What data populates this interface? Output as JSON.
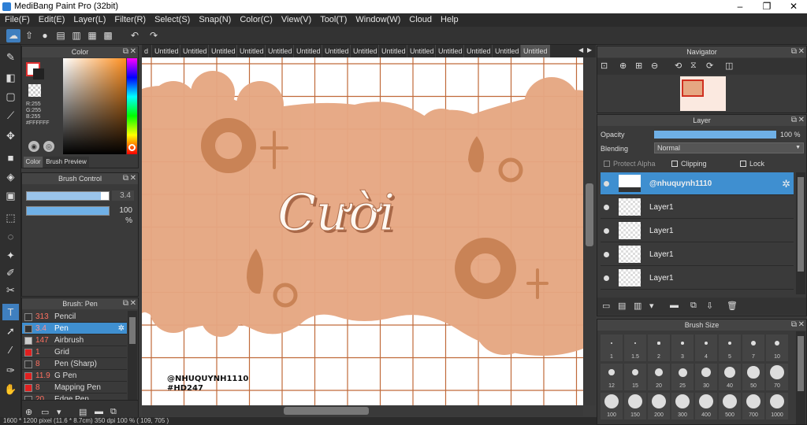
{
  "window": {
    "title": "MediBang Paint Pro (32bit)",
    "min": "–",
    "max": "❐",
    "close": "✕"
  },
  "menu": [
    "File(F)",
    "Edit(E)",
    "Layer(L)",
    "Filter(R)",
    "Select(S)",
    "Snap(N)",
    "Color(C)",
    "View(V)",
    "Tool(T)",
    "Window(W)",
    "Cloud",
    "Help"
  ],
  "tabs": {
    "first_partial": "d",
    "items": [
      "Untitled",
      "Untitled",
      "Untitled",
      "Untitled",
      "Untitled",
      "Untitled",
      "Untitled",
      "Untitled",
      "Untitled",
      "Untitled",
      "Untitled",
      "Untitled",
      "Untitled",
      "Untitled"
    ],
    "selected_index": 13
  },
  "color_panel": {
    "title": "Color",
    "r": "R:255",
    "g": "G:255",
    "b": "B:255",
    "hex": "#FFFFFF",
    "tab_color": "Color",
    "tab_brush_preview": "Brush Preview",
    "primary": "#e03030",
    "secondary": "#ffffff"
  },
  "brush_control": {
    "title": "Brush Control",
    "size_value": "3.4",
    "opacity_value": "100 %",
    "size_fill": 0.9,
    "opacity_fill": 1.0
  },
  "brush_list": {
    "title": "Brush: Pen",
    "items": [
      {
        "size": "313",
        "name": "Pencil",
        "color": "#333333"
      },
      {
        "size": "3.4",
        "name": "Pen",
        "color": "#333333"
      },
      {
        "size": "147",
        "name": "Airbrush",
        "color": "#cccccc"
      },
      {
        "size": "1",
        "name": "Grid",
        "color": "#e02020"
      },
      {
        "size": "8",
        "name": "Pen (Sharp)",
        "color": "#333333"
      },
      {
        "size": "11.9",
        "name": "G Pen",
        "color": "#e02020"
      },
      {
        "size": "8",
        "name": "Mapping Pen",
        "color": "#e02020"
      },
      {
        "size": "20",
        "name": "Edge Pen",
        "color": "#333333"
      }
    ],
    "selected_index": 1
  },
  "navigator": {
    "title": "Navigator"
  },
  "layer": {
    "title": "Layer",
    "opacity_label": "Opacity",
    "opacity_value": "100 %",
    "opacity_fill": 1.0,
    "blending_label": "Blending",
    "blending_value": "Normal",
    "protect_alpha": "Protect Alpha",
    "clipping": "Clipping",
    "lock": "Lock",
    "items": [
      {
        "name": "@nhuquynh1110"
      },
      {
        "name": "Layer1"
      },
      {
        "name": "Layer1"
      },
      {
        "name": "Layer1"
      },
      {
        "name": "Layer1"
      }
    ],
    "selected_index": 0
  },
  "brush_size": {
    "title": "Brush Size",
    "row1": [
      "1",
      "1.5",
      "2",
      "3",
      "4",
      "5",
      "7",
      "10"
    ],
    "row2": [
      "12",
      "15",
      "20",
      "25",
      "30",
      "40",
      "50",
      "70"
    ],
    "row3": [
      "100",
      "150",
      "200",
      "300",
      "400",
      "500",
      "700",
      "1000"
    ]
  },
  "canvas": {
    "headline": "Cười",
    "watermark_1": "@NHUQUYNH1110",
    "watermark_2": "#HD247"
  },
  "status": {
    "text": "1600 * 1200 pixel   (11.6 * 8.7cm)   350 dpi   100 %   ( 109, 705 )"
  },
  "colors": {
    "accent": "#3f8fd0",
    "grid": "#c06a3a",
    "blob": "#e6a782",
    "blob_dark": "#c98356"
  }
}
